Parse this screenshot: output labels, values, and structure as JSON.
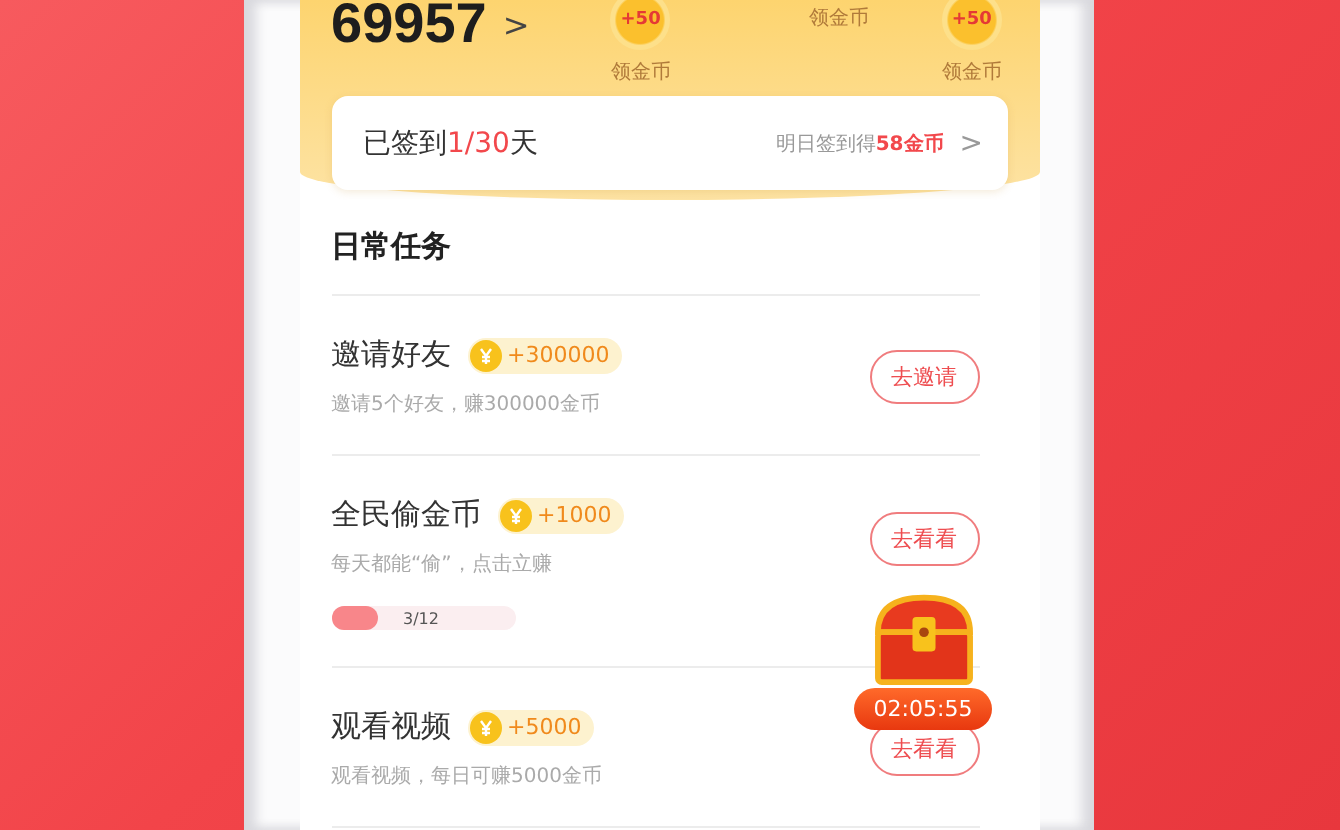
{
  "balance": {
    "value": "69957",
    "arrow": ">"
  },
  "coins": [
    {
      "amount": "+50",
      "label": "领金币"
    },
    {
      "label": "领金币"
    },
    {
      "amount": "+50",
      "label": "领金币"
    }
  ],
  "signin": {
    "status": "已签到**1/30**天",
    "reward": "明日签到得**58金币**",
    "arrow": ">"
  },
  "section_title": "日常任务",
  "tasks": [
    {
      "title": "邀请好友",
      "reward": "+300000",
      "desc": "邀请5个好友，赚300000金币",
      "button": "去邀请"
    },
    {
      "title": "全民偷金币",
      "reward": "+1000",
      "desc": "每天都能“偷”，点击立赚",
      "button": "去看看",
      "progress": {
        "level": 0.25,
        "text": "3/12"
      }
    },
    {
      "title": "观看视频",
      "reward": "+5000",
      "desc": "观看视频，每日可赚5000金币",
      "button": "去看看"
    }
  ],
  "treasure": {
    "timer": "02:05:55"
  }
}
